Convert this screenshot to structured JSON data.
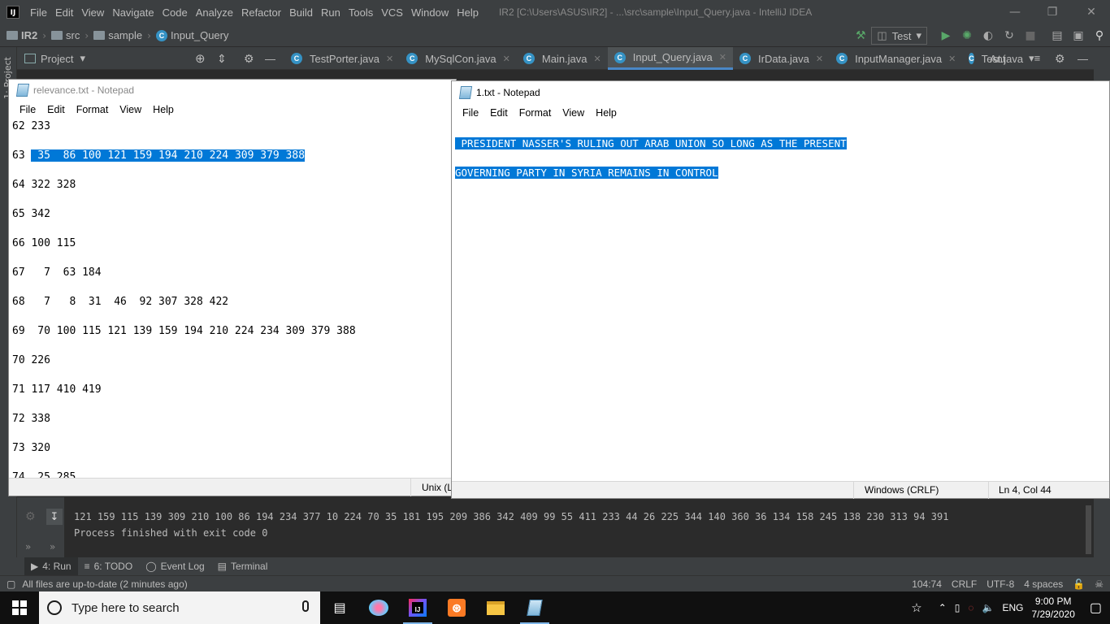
{
  "ide": {
    "menu": [
      "File",
      "Edit",
      "View",
      "Navigate",
      "Code",
      "Analyze",
      "Refactor",
      "Build",
      "Run",
      "Tools",
      "VCS",
      "Window",
      "Help"
    ],
    "window_title": "IR2 [C:\\Users\\ASUS\\IR2] - ...\\src\\sample\\Input_Query.java - IntelliJ IDEA",
    "breadcrumbs": [
      "IR2",
      "src",
      "sample",
      "Input_Query"
    ],
    "run_config": "Test",
    "project_label": "Project",
    "side_tab": "1: Project",
    "tabs": [
      {
        "label": "TestPorter.java",
        "active": false
      },
      {
        "label": "MySqlCon.java",
        "active": false
      },
      {
        "label": "Main.java",
        "active": false
      },
      {
        "label": "Input_Query.java",
        "active": true
      },
      {
        "label": "IrData.java",
        "active": false
      },
      {
        "label": "InputManager.java",
        "active": false
      },
      {
        "label": "Test.java",
        "active": false
      }
    ],
    "ant_label": "Ant",
    "run_output": [
      "121 159 115 139 309 210 100 86 194 234 377 10 224 70 35 181 195 209 386 342 409 99 55 411 233 44 26 225 344 140 360 36 134 158 245 138 230 313 94 391",
      "Process finished with exit code 0"
    ],
    "tool_windows": [
      {
        "label": "4: Run",
        "active": true
      },
      {
        "label": "6: TODO",
        "active": false
      },
      {
        "label": "Event Log",
        "active": false
      },
      {
        "label": "Terminal",
        "active": false
      }
    ],
    "status_left": "All files are up-to-date (2 minutes ago)",
    "status_right": {
      "position": "104:74",
      "line_sep": "CRLF",
      "encoding": "UTF-8",
      "indent": "4 spaces"
    }
  },
  "notepad_left": {
    "title": "relevance.txt - Notepad",
    "menu": [
      "File",
      "Edit",
      "Format",
      "View",
      "Help"
    ],
    "lines": [
      {
        "prefix": "62 233",
        "selected": ""
      },
      {
        "prefix": "63 ",
        "selected": " 35  86 100 121 159 194 210 224 309 379 388"
      },
      {
        "prefix": "64 322 328",
        "selected": ""
      },
      {
        "prefix": "65 342",
        "selected": ""
      },
      {
        "prefix": "66 100 115",
        "selected": ""
      },
      {
        "prefix": "67   7  63 184",
        "selected": ""
      },
      {
        "prefix": "68   7   8  31  46  92 307 328 422",
        "selected": ""
      },
      {
        "prefix": "69  70 100 115 121 139 159 194 210 224 234 309 379 388",
        "selected": ""
      },
      {
        "prefix": "70 226",
        "selected": ""
      },
      {
        "prefix": "71 117 410 419",
        "selected": ""
      },
      {
        "prefix": "72 338",
        "selected": ""
      },
      {
        "prefix": "73 320",
        "selected": ""
      },
      {
        "prefix": "74  25 285",
        "selected": ""
      }
    ],
    "status_encoding": "Unix (L"
  },
  "notepad_right": {
    "title": "1.txt - Notepad",
    "menu": [
      "File",
      "Edit",
      "Format",
      "View",
      "Help"
    ],
    "lines": [
      " PRESIDENT NASSER'S RULING OUT ARAB UNION SO LONG AS THE PRESENT",
      "GOVERNING PARTY IN SYRIA REMAINS IN CONTROL"
    ],
    "status_eol": "Windows (CRLF)",
    "status_pos": "Ln 4, Col 44"
  },
  "taskbar": {
    "search_placeholder": "Type here to search",
    "lang": "ENG",
    "time": "9:00 PM",
    "date": "7/29/2020"
  }
}
